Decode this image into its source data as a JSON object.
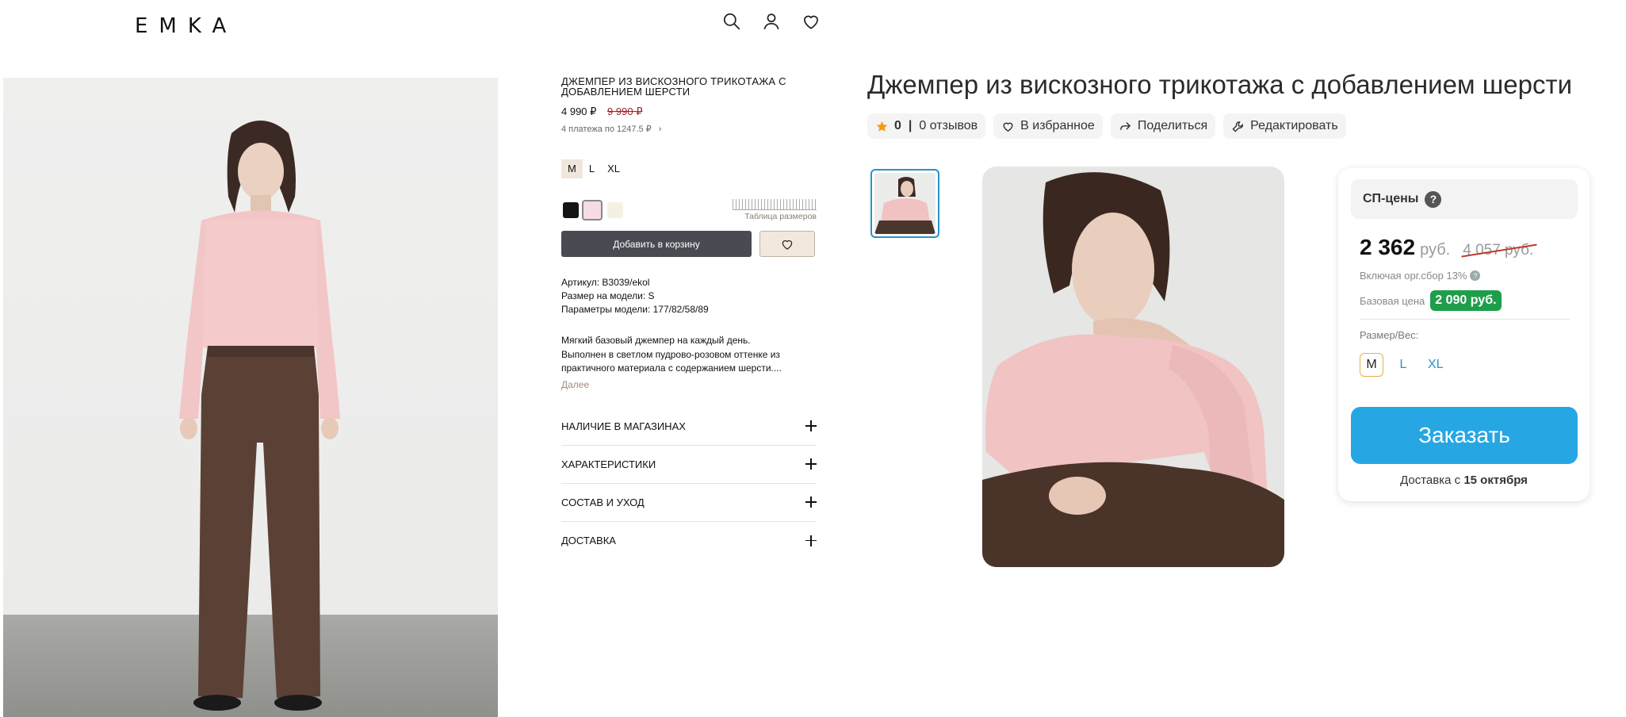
{
  "shop": {
    "logo": "EMKA",
    "header_icons": [
      "search-icon",
      "user-icon",
      "heart-icon"
    ]
  },
  "product": {
    "title": "ДЖЕМПЕР ИЗ ВИСКОЗНОГО ТРИКОТАЖА С ДОБАВЛЕНИЕМ ШЕРСТИ",
    "price": "4 990 ₽",
    "old_price": "9 990 ₽",
    "installments": "4 платежа по 1247.5 ₽",
    "sizes": [
      "M",
      "L",
      "XL"
    ],
    "selected_size": "M",
    "colors": [
      "#151515",
      "#f6dde3",
      "#f4f1e4"
    ],
    "size_table": "Таблица размеров",
    "add_to_cart": "Добавить в корзину",
    "attributes": [
      "Артикул: B3039/ekol",
      "Размер на модели: S",
      "Параметры модели: 177/82/58/89"
    ],
    "description": [
      "Мягкий базовый джемпер на каждый день.",
      "Выполнен в светлом пудрово-розовом оттенке из",
      "практичного материала с содержанием шерсти...."
    ],
    "more_link": "Далее",
    "accordion": [
      "НАЛИЧИЕ В МАГАЗИНАХ",
      "ХАРАКТЕРИСТИКИ",
      "СОСТАВ И УХОД",
      "ДОСТАВКА"
    ]
  },
  "marketplace": {
    "title": "Джемпер из вискозного трикотажа с добавлением шерсти",
    "rating": "0",
    "reviews": "0 отзывов",
    "favorite": "В избранное",
    "share": "Поделиться",
    "edit": "Редактировать",
    "sp_label": "СП-цены",
    "price": "2 362",
    "currency": "руб.",
    "old_price": "4 057 руб.",
    "fee_note": "Включая орг.сбор 13%",
    "base_price_label": "Базовая цена",
    "base_price": "2 090 руб.",
    "size_label": "Размер/Вес:",
    "sizes": [
      "M",
      "L",
      "XL"
    ],
    "selected_size": "M",
    "order_button": "Заказать",
    "delivery_prefix": "Доставка с",
    "delivery_date": "15 октября",
    "accent_color": "#27a6e4",
    "badge_color": "#1e9e4a"
  }
}
